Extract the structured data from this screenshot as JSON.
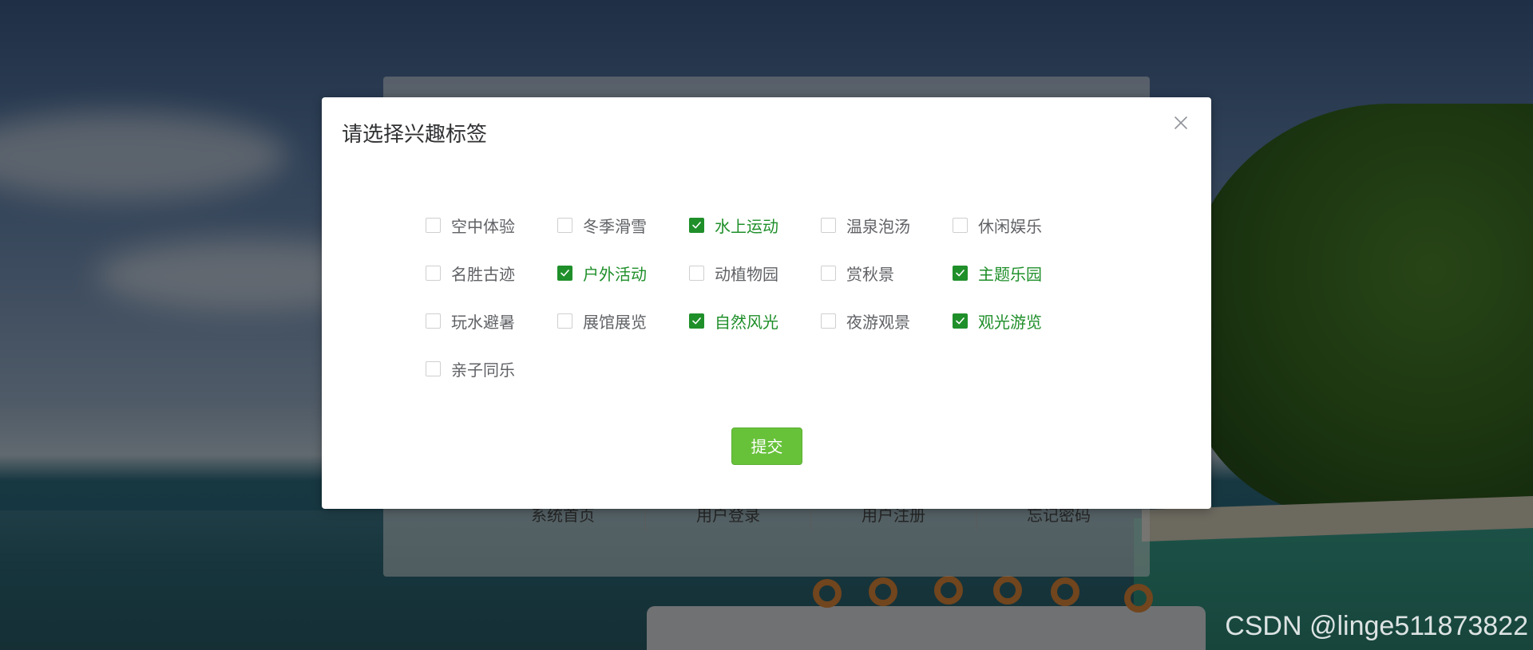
{
  "background_panel": {
    "links": [
      "系统首页",
      "用户登录",
      "用户注册",
      "忘记密码"
    ]
  },
  "dialog": {
    "title": "请选择兴趣标签",
    "close_icon": "close-icon",
    "submit_label": "提交",
    "accent_color": "#1f8f2a",
    "submit_color": "#67c23a",
    "tags": [
      {
        "label": "空中体验",
        "checked": false
      },
      {
        "label": "冬季滑雪",
        "checked": false
      },
      {
        "label": "水上运动",
        "checked": true
      },
      {
        "label": "温泉泡汤",
        "checked": false
      },
      {
        "label": "休闲娱乐",
        "checked": false
      },
      {
        "label": "名胜古迹",
        "checked": false
      },
      {
        "label": "户外活动",
        "checked": true
      },
      {
        "label": "动植物园",
        "checked": false
      },
      {
        "label": "赏秋景",
        "checked": false
      },
      {
        "label": "主题乐园",
        "checked": true
      },
      {
        "label": "玩水避暑",
        "checked": false
      },
      {
        "label": "展馆展览",
        "checked": false
      },
      {
        "label": "自然风光",
        "checked": true
      },
      {
        "label": "夜游观景",
        "checked": false
      },
      {
        "label": "观光游览",
        "checked": true
      },
      {
        "label": "亲子同乐",
        "checked": false
      }
    ]
  },
  "watermark": "CSDN @linge511873822"
}
